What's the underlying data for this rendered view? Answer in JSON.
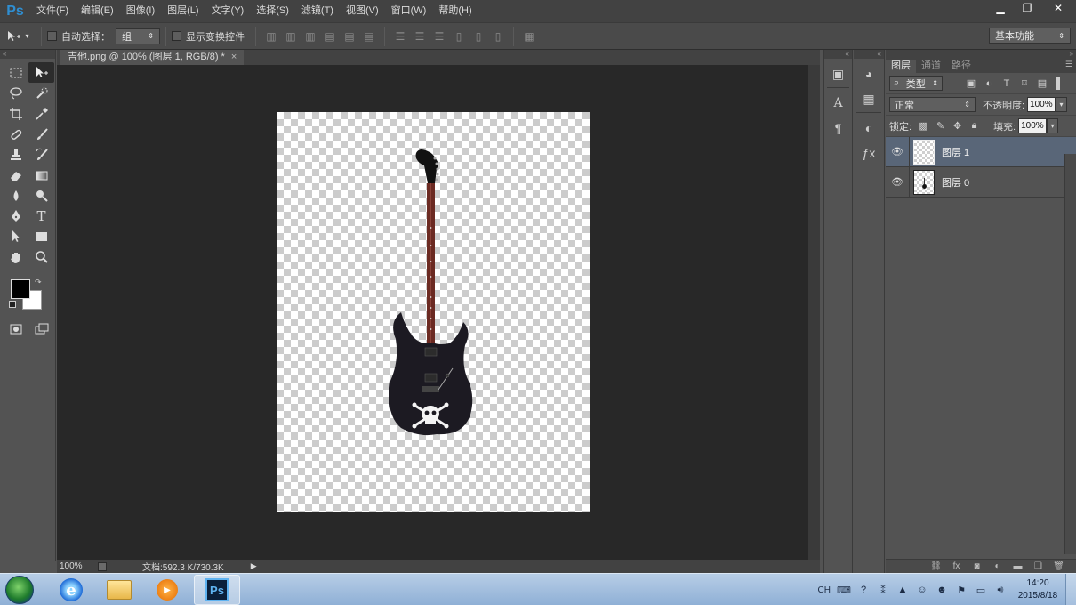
{
  "app": {
    "logo": "Ps",
    "menu": [
      "文件(F)",
      "编辑(E)",
      "图像(I)",
      "图层(L)",
      "文字(Y)",
      "选择(S)",
      "滤镜(T)",
      "视图(V)",
      "窗口(W)",
      "帮助(H)"
    ],
    "window_controls": {
      "minimize": "▁",
      "restore": "❐",
      "close": "✕"
    }
  },
  "options_bar": {
    "tool_icon": "move-tool-icon",
    "auto_select_label": "自动选择：",
    "auto_select_checked": false,
    "auto_select_target": "组",
    "show_transform_label": "显示变换控件",
    "show_transform_checked": false,
    "workspace": "基本功能"
  },
  "document": {
    "tab_title": "吉他.png @ 100% (图层 1, RGB/8) *",
    "tab_close": "×",
    "zoom": "100%",
    "doc_info": "文档:592.3 K/730.3K",
    "status_arrow": "▶"
  },
  "layers_panel": {
    "tabs": [
      "图层",
      "通道",
      "路径"
    ],
    "active_tab": 0,
    "filter_kind": "类型",
    "blend_mode": "正常",
    "opacity_label": "不透明度:",
    "opacity_value": "100%",
    "lock_label": "锁定:",
    "fill_label": "填充:",
    "fill_value": "100%",
    "layers": [
      {
        "name": "图层 1",
        "selected": true,
        "visible": true
      },
      {
        "name": "图层 0",
        "selected": false,
        "visible": true
      }
    ]
  },
  "taskbar": {
    "ps_label": "Ps",
    "tray_lang": "CH",
    "time": "14:20",
    "date": "2015/8/18"
  },
  "colors": {
    "foreground": "#000000",
    "background": "#ffffff",
    "selected_layer": "#596678"
  }
}
